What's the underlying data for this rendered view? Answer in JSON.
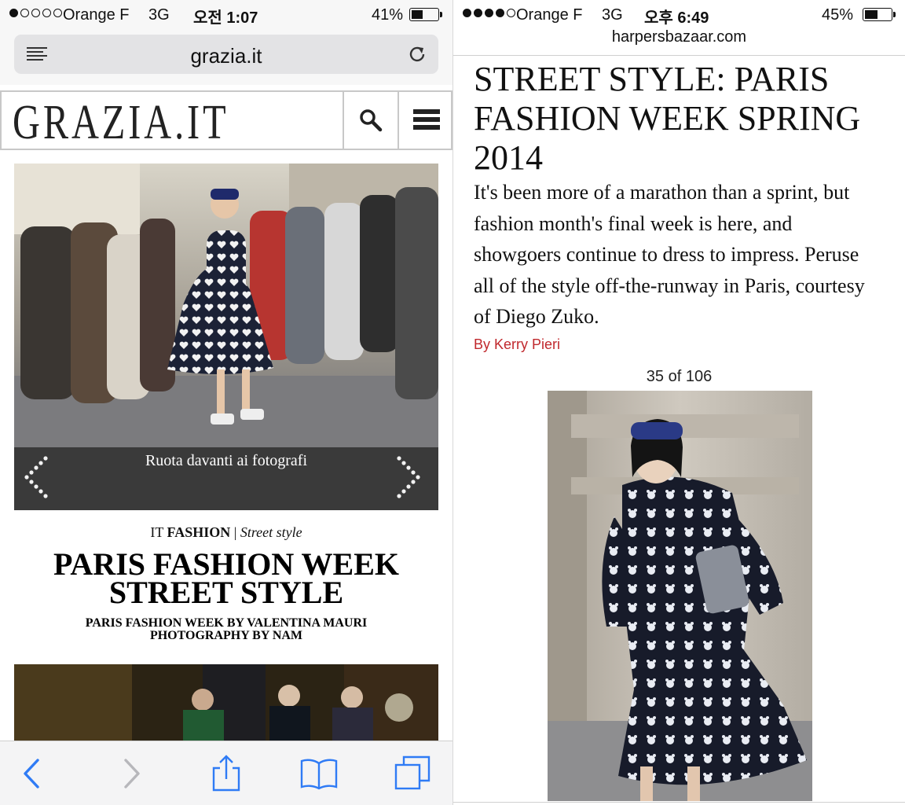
{
  "left": {
    "status": {
      "carrier": "Orange F",
      "network": "3G",
      "time": "오전 1:07",
      "battery_percent": "41%",
      "signal_bars": 1,
      "battery_level": 0.41
    },
    "browser": {
      "url_domain": "grazia.it"
    },
    "site": {
      "logo": "GRAZIA.IT"
    },
    "slideshow": {
      "caption": "Ruota davanti ai fotografi"
    },
    "article": {
      "category_prefix": "IT",
      "category": "FASHION",
      "subcategory": "Street style",
      "title_line1": "PARIS FASHION WEEK",
      "title_line2": "STREET STYLE",
      "credit_line1": "PARIS FASHION WEEK BY VALENTINA MAURI",
      "credit_line2": "PHOTOGRAPHY BY NAM"
    },
    "toolbar": {
      "icons": [
        "back-icon",
        "forward-icon",
        "share-icon",
        "bookmarks-icon",
        "tabs-icon"
      ]
    }
  },
  "right": {
    "status": {
      "carrier": "Orange F",
      "network": "3G",
      "time": "오후 6:49",
      "battery_percent": "45%",
      "signal_bars": 4,
      "battery_level": 0.45
    },
    "browser": {
      "url_domain": "harpersbazaar.com"
    },
    "article": {
      "title": "STREET STYLE: PARIS FASHION WEEK SPRING 2014",
      "description": "It's been more of a marathon than a sprint, but fashion month's final week is here, and showgoers continue to dress to impress. Peruse all of the style off-the-runway in Paris, courtesy of Diego Zuko.",
      "byline": "By Kerry Pieri",
      "slide_counter": "35 of 106"
    },
    "colors": {
      "byline": "#c0282d"
    }
  }
}
